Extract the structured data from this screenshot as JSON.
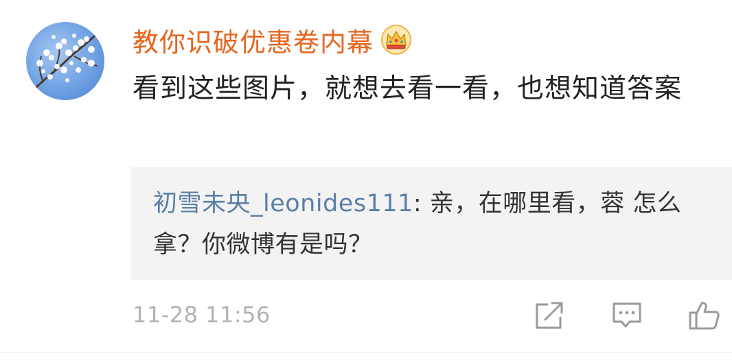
{
  "comment": {
    "username": "教你识破优惠卷内幕",
    "badge_icon": "crown-icon",
    "text": "看到这些图片，就想去看一看，也想知道答案",
    "timestamp": "11-28 11:56"
  },
  "reply": {
    "username": "初雪未央_leonides111",
    "separator": ": ",
    "text": "亲，在哪里看，蓉 怎么拿？你微博有是吗？"
  },
  "actions": {
    "share_icon": "share-icon",
    "comment_icon": "comment-icon",
    "like_icon": "like-icon"
  },
  "colors": {
    "username": "#e6661f",
    "reply_username": "#5b7fa6",
    "reply_background": "#f3f3f3",
    "timestamp": "#b2b2b2"
  }
}
